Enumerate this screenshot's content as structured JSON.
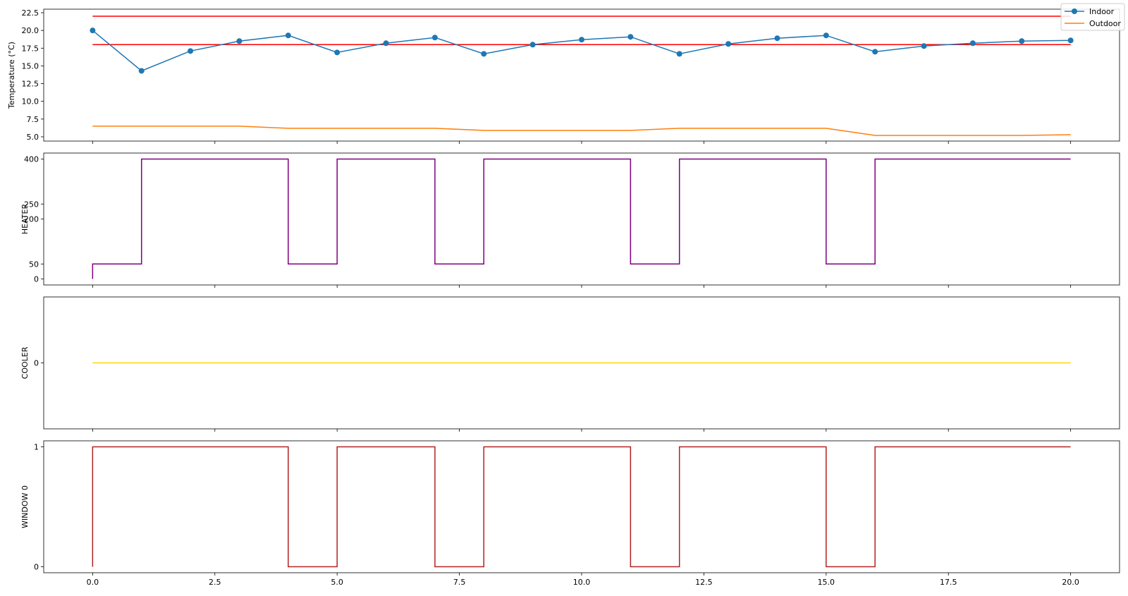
{
  "chart_data": [
    {
      "type": "line",
      "title": "",
      "xlabel": "",
      "ylabel": "Temperature (°C)",
      "xlim": [
        -1,
        21
      ],
      "ylim": [
        4.4,
        23.0
      ],
      "xticks": [
        0,
        2.5,
        5,
        7.5,
        10,
        12.5,
        15,
        17.5,
        20
      ],
      "xticklabels": [],
      "yticks": [
        5,
        7.5,
        10,
        12.5,
        15,
        17.5,
        20,
        22.5
      ],
      "yticklabels": [
        "5.0",
        "7.5",
        "10.0",
        "12.5",
        "15.0",
        "17.5",
        "20.0",
        "22.5"
      ],
      "legend": {
        "placement": "upper-right",
        "entries": [
          "Indoor",
          "Outdoor"
        ]
      },
      "hlines": [
        {
          "y": 22,
          "color": "#ff0000"
        },
        {
          "y": 18,
          "color": "#ff0000"
        }
      ],
      "series": [
        {
          "name": "Indoor",
          "color": "#1f77b4",
          "marker": "circle",
          "x": [
            0,
            1,
            2,
            3,
            4,
            5,
            6,
            7,
            8,
            9,
            10,
            11,
            12,
            13,
            14,
            15,
            16,
            17,
            18,
            19,
            20
          ],
          "values": [
            20.0,
            14.3,
            17.1,
            18.5,
            19.3,
            16.9,
            18.2,
            19.0,
            16.7,
            18.0,
            18.7,
            19.1,
            16.7,
            18.1,
            18.9,
            19.3,
            17.0,
            17.8,
            18.2,
            18.5,
            18.6
          ]
        },
        {
          "name": "Outdoor",
          "color": "#ff7f0e",
          "marker": "none",
          "x": [
            0,
            1,
            2,
            3,
            4,
            5,
            6,
            7,
            8,
            9,
            10,
            11,
            12,
            13,
            14,
            15,
            16,
            17,
            18,
            19,
            20
          ],
          "values": [
            6.5,
            6.5,
            6.5,
            6.5,
            6.2,
            6.2,
            6.2,
            6.2,
            5.9,
            5.9,
            5.9,
            5.9,
            6.2,
            6.2,
            6.2,
            6.2,
            5.2,
            5.2,
            5.2,
            5.2,
            5.3
          ]
        }
      ]
    },
    {
      "type": "line",
      "step": "post",
      "title": "",
      "xlabel": "",
      "ylabel": "HEATER",
      "xlim": [
        -1,
        21
      ],
      "ylim": [
        -20,
        420
      ],
      "xticks": [
        0,
        2.5,
        5,
        7.5,
        10,
        12.5,
        15,
        17.5,
        20
      ],
      "xticklabels": [],
      "yticks": [
        0,
        50,
        200,
        250,
        400
      ],
      "yticklabels": [
        "0",
        "50",
        "200",
        "250",
        "400"
      ],
      "series": [
        {
          "color": "#800080",
          "x": [
            0,
            0,
            1,
            4,
            5,
            7,
            8,
            11,
            12,
            15,
            16,
            20
          ],
          "values": [
            0,
            50,
            400,
            50,
            400,
            50,
            400,
            50,
            400,
            50,
            400,
            400
          ]
        }
      ]
    },
    {
      "type": "line",
      "step": "post",
      "title": "",
      "xlabel": "",
      "ylabel": "COOLER",
      "xlim": [
        -1,
        21
      ],
      "ylim": [
        -1,
        1
      ],
      "xticks": [
        0,
        2.5,
        5,
        7.5,
        10,
        12.5,
        15,
        17.5,
        20
      ],
      "xticklabels": [],
      "yticks": [
        0
      ],
      "yticklabels": [
        "0"
      ],
      "series": [
        {
          "color": "#ffd700",
          "x": [
            0,
            20
          ],
          "values": [
            0,
            0
          ]
        }
      ]
    },
    {
      "type": "line",
      "step": "post",
      "title": "",
      "xlabel": "",
      "ylabel": "WINDOW 0",
      "xlim": [
        -1,
        21
      ],
      "ylim": [
        -0.05,
        1.05
      ],
      "xticks": [
        0,
        2.5,
        5,
        7.5,
        10,
        12.5,
        15,
        17.5,
        20
      ],
      "xticklabels": [
        "0.0",
        "2.5",
        "5.0",
        "7.5",
        "10.0",
        "12.5",
        "15.0",
        "17.5",
        "20.0"
      ],
      "yticks": [
        0,
        1
      ],
      "yticklabels": [
        "0",
        "1"
      ],
      "series": [
        {
          "color": "#b22222",
          "x": [
            0,
            0,
            4,
            5,
            7,
            8,
            11,
            12,
            15,
            16,
            20
          ],
          "values": [
            0,
            1,
            0,
            1,
            0,
            1,
            0,
            1,
            0,
            1,
            1
          ]
        }
      ]
    }
  ]
}
